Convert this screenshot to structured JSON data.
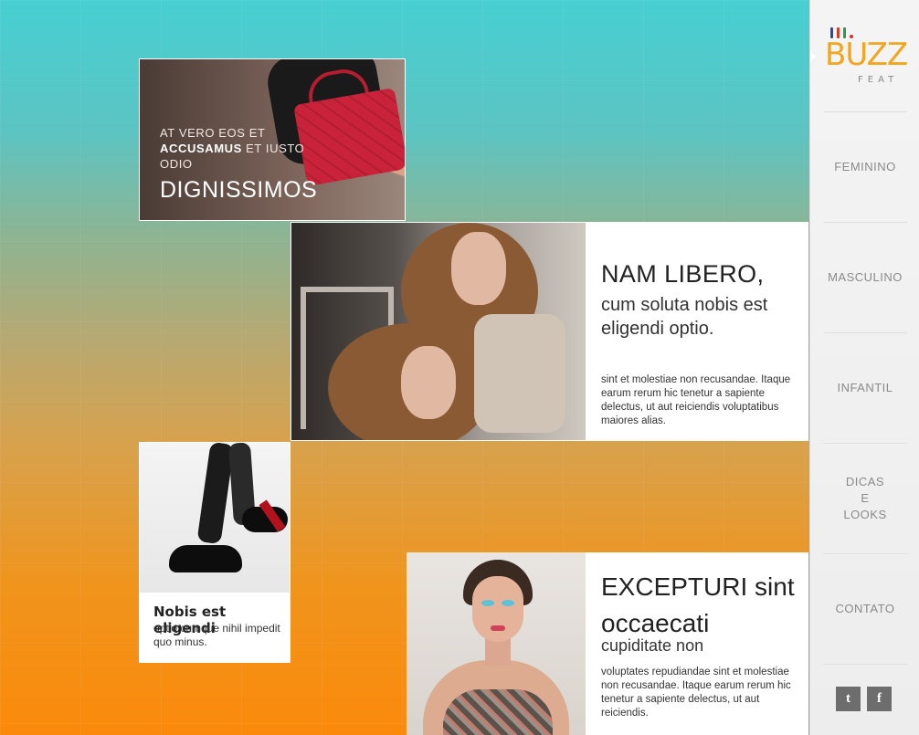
{
  "logo": {
    "word": "BUZZ",
    "sub": "FEAT",
    "bar_colors": [
      "#2c4a9c",
      "#d63b2c",
      "#2c9a4a",
      "#d6342e"
    ]
  },
  "nav": {
    "items": [
      {
        "label": "FEMININO"
      },
      {
        "label": "MASCULINO"
      },
      {
        "label": "INFANTIL"
      },
      {
        "label": "DICAS\nE\nLOOKS"
      },
      {
        "label": "CONTATO"
      }
    ]
  },
  "social": {
    "twitter_icon": "twitter-icon",
    "twitter_glyph": "t",
    "facebook_icon": "facebook-icon",
    "facebook_glyph": "f"
  },
  "feature1": {
    "line1": "AT VERO EOS ET",
    "line2_bold": "ACCUSAMUS",
    "line2_rest": " ET IUSTO",
    "line3": "ODIO",
    "headline": "DIGNISSIMOS"
  },
  "feature2": {
    "title": "NAM LIBERO,",
    "subtitle": "cum soluta nobis est eligendi optio.",
    "body": "sint et molestiae non recusandae. Itaque earum rerum hic tenetur a sapiente delectus, ut aut reiciendis voluptatibus maiores alias."
  },
  "feature3": {
    "title": "Nobis est eligendi",
    "body": "optio cumque  nihil impedit quo minus."
  },
  "feature4": {
    "title": "EXCEPTURI sint occaecati",
    "subtitle": "cupiditate non",
    "body": "voluptates repudiandae sint et molestiae non recusandae. Itaque earum rerum hic tenetur a sapiente delectus, ut aut reiciendis."
  },
  "colors": {
    "gradient_top": "#47cfd2",
    "gradient_bottom": "#fb8a0c",
    "logo_orange": "#f2a51f"
  }
}
